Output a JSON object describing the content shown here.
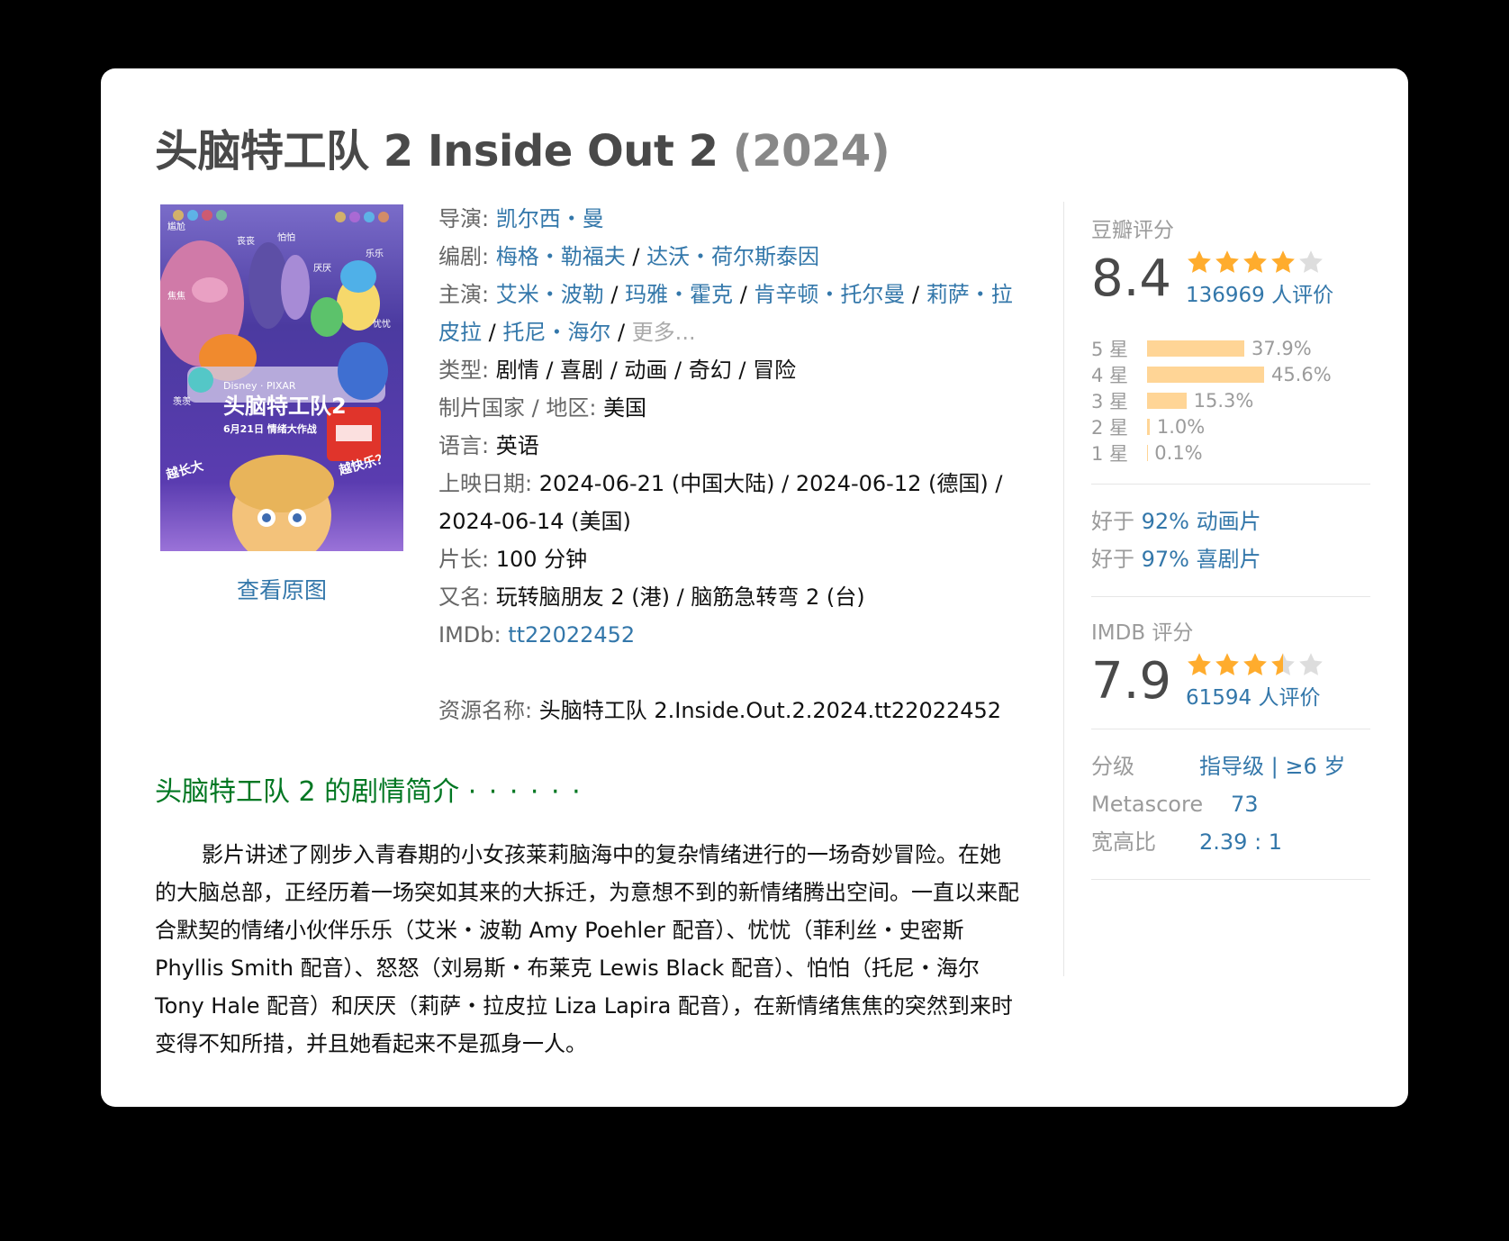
{
  "title": {
    "main": "头脑特工队 2 Inside Out 2",
    "year": "(2024)"
  },
  "poster": {
    "link": "查看原图",
    "texts": [
      "尴尬",
      "丧丧",
      "怕怕",
      "厌厌",
      "乐乐",
      "忧忧",
      "焦焦",
      "羡羡",
      "头脑特工队2",
      "6月21日 情绪大作战",
      "越长大",
      "越快乐？",
      "Disney · PIXAR"
    ]
  },
  "info": {
    "director": {
      "label": "导演",
      "value": "凯尔西・曼"
    },
    "writers": {
      "label": "编剧",
      "values": [
        "梅格・勒福夫",
        "达沃・荷尔斯泰因"
      ]
    },
    "cast": {
      "label": "主演",
      "values": [
        "艾米・波勒",
        "玛雅・霍克",
        "肯辛顿・托尔曼",
        "莉萨・拉皮拉",
        "托尼・海尔"
      ],
      "more": "更多..."
    },
    "genre": {
      "label": "类型",
      "value": "剧情 / 喜剧 / 动画 / 奇幻 / 冒险"
    },
    "country": {
      "label": "制片国家 / 地区",
      "value": "美国"
    },
    "language": {
      "label": "语言",
      "value": "英语"
    },
    "release": {
      "label": "上映日期",
      "value": "2024-06-21 (中国大陆) / 2024-06-12 (德国) / 2024-06-14 (美国)"
    },
    "runtime": {
      "label": "片长",
      "value": "100 分钟"
    },
    "aka": {
      "label": "又名",
      "value": "玩转脑朋友 2 (港) / 脑筋急转弯 2 (台)"
    },
    "imdb": {
      "label": "IMDb",
      "value": "tt22022452"
    },
    "resource": {
      "label": "资源名称",
      "value": "头脑特工队 2.Inside.Out.2.2024.tt22022452"
    }
  },
  "synopsis": {
    "title": "头脑特工队 2 的剧情简介",
    "dots": "· · · · · ·",
    "text": "影片讲述了刚步入青春期的小女孩莱莉脑海中的复杂情绪进行的一场奇妙冒险。在她的大脑总部，正经历着一场突如其来的大拆迁，为意想不到的新情绪腾出空间。一直以来配合默契的情绪小伙伴乐乐（艾米・波勒 Amy Poehler 配音）、忧忧（菲利丝・史密斯 Phyllis Smith 配音）、怒怒（刘易斯・布莱克 Lewis Black 配音）、怕怕（托尼・海尔 Tony Hale 配音）和厌厌（莉萨・拉皮拉 Liza Lapira 配音），在新情绪焦焦的突然到来时变得不知所措，并且她看起来不是孤身一人。"
  },
  "douban": {
    "label": "豆瓣评分",
    "score": "8.4",
    "stars": 4.0,
    "votes": "136969 人评价",
    "distribution": [
      {
        "label": "5 星",
        "pct": "37.9%",
        "value": 37.9
      },
      {
        "label": "4 星",
        "pct": "45.6%",
        "value": 45.6
      },
      {
        "label": "3 星",
        "pct": "15.3%",
        "value": 15.3
      },
      {
        "label": "2 星",
        "pct": "1.0%",
        "value": 1.0
      },
      {
        "label": "1 星",
        "pct": "0.1%",
        "value": 0.1
      }
    ],
    "better_than": [
      {
        "prefix": "好于",
        "link": "92% 动画片"
      },
      {
        "prefix": "好于",
        "link": "97% 喜剧片"
      }
    ]
  },
  "imdb_rating": {
    "label": "IMDB 评分",
    "score": "7.9",
    "stars": 3.5,
    "votes": "61594 人评价"
  },
  "meta": [
    {
      "key": "分级",
      "value": "指导级 | ≥6 岁"
    },
    {
      "key": "Metascore",
      "value": "73"
    },
    {
      "key": "宽高比",
      "value": "2.39 : 1"
    }
  ],
  "colors": {
    "link": "#3377aa",
    "synopsis_title": "#007722",
    "star": "#ffac2d",
    "bar": "#ffd596"
  }
}
